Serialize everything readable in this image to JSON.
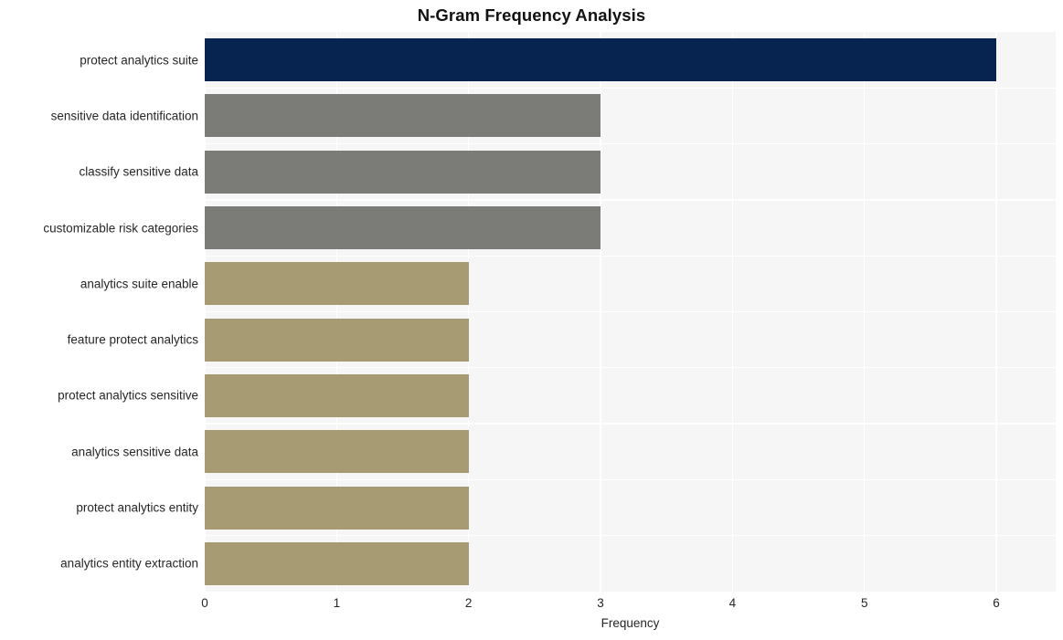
{
  "chart_data": {
    "type": "bar",
    "orientation": "horizontal",
    "title": "N-Gram Frequency Analysis",
    "xlabel": "Frequency",
    "ylabel": "",
    "xlim": [
      0,
      6.45
    ],
    "xticks": [
      0,
      1,
      2,
      3,
      4,
      5,
      6
    ],
    "xticklabels": [
      "0",
      "1",
      "2",
      "3",
      "4",
      "5",
      "6"
    ],
    "grid": true,
    "legend": false,
    "categories": [
      "protect analytics suite",
      "sensitive data identification",
      "classify sensitive data",
      "customizable risk categories",
      "analytics suite enable",
      "feature protect analytics",
      "protect analytics sensitive",
      "analytics sensitive data",
      "protect analytics entity",
      "analytics entity extraction"
    ],
    "values": [
      6,
      3,
      3,
      3,
      2,
      2,
      2,
      2,
      2,
      2
    ],
    "bar_colors": [
      "#06244f",
      "#7b7b77",
      "#7b7b77",
      "#7b7b77",
      "#a69b72",
      "#a69b72",
      "#a69b72",
      "#a69b72",
      "#a69b72",
      "#a69b72"
    ]
  },
  "style": {
    "figure_background": "#ffffff",
    "plot_background": "#f6f6f6",
    "gridline_color": "#ffffff",
    "text_color": "#262626",
    "title_color": "#121212"
  }
}
